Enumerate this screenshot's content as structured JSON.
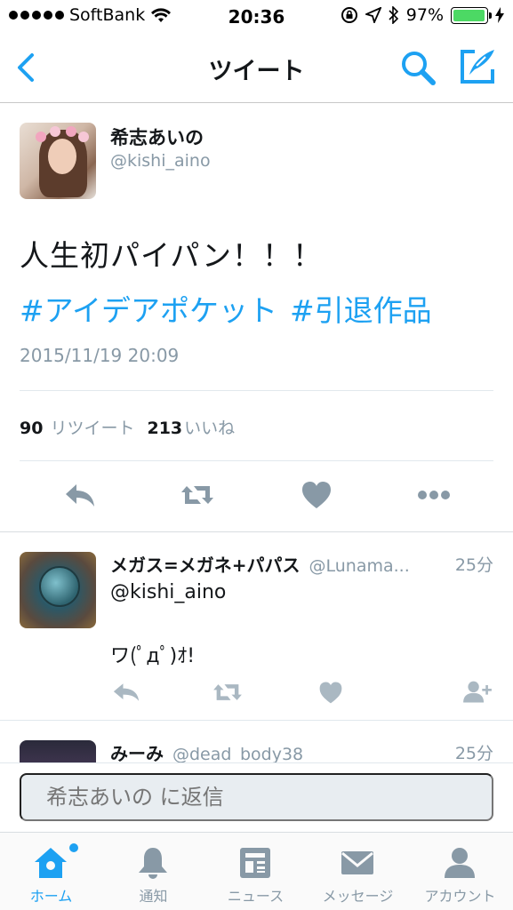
{
  "status_bar": {
    "carrier": "SoftBank",
    "time": "20:36",
    "battery": "97%",
    "battery_level": 0.97,
    "icons": [
      "signal-dots-icon",
      "wifi-icon",
      "rotation-lock-icon",
      "location-icon",
      "bluetooth-icon",
      "battery-icon",
      "charging-icon"
    ]
  },
  "nav": {
    "title": "ツイート",
    "icons": [
      "back-chevron-icon",
      "search-icon",
      "compose-icon"
    ]
  },
  "tweet": {
    "author_name": "希志あいの",
    "author_handle": "@kishi_aino",
    "text": "人生初パイパン！！！",
    "hashtags": [
      "#アイデアポケット",
      "#引退作品"
    ],
    "date": "2015/11/19 20:09",
    "retweet_count": "90",
    "retweet_label": "リツイート",
    "like_count": "213",
    "like_label": "いいね",
    "action_icons": [
      "reply-icon",
      "retweet-icon",
      "like-heart-icon",
      "more-dots-icon"
    ]
  },
  "replies": [
    {
      "name": "メガス=メガネ+パパス",
      "handle": "@Lunama...",
      "time": "25分",
      "line1": "@kishi_aino",
      "line2": "ワ(ﾟдﾟ)ｵ!",
      "action_icons": [
        "reply-icon",
        "retweet-icon",
        "like-heart-icon",
        "follow-user-icon"
      ]
    },
    {
      "name": "みーみ",
      "handle": "@dead_body38",
      "time": "25分"
    }
  ],
  "reply_box": {
    "placeholder": "希志あいの に返信"
  },
  "tabs": [
    {
      "label": "ホーム",
      "icon": "home-icon",
      "active": true
    },
    {
      "label": "通知",
      "icon": "bell-icon",
      "active": false
    },
    {
      "label": "ニュース",
      "icon": "news-icon",
      "active": false
    },
    {
      "label": "メッセージ",
      "icon": "envelope-icon",
      "active": false
    },
    {
      "label": "アカウント",
      "icon": "person-icon",
      "active": false
    }
  ],
  "colors": {
    "accent": "#1da1f2",
    "muted": "#8899a6",
    "text": "#14171a",
    "battery": "#4cd964"
  }
}
